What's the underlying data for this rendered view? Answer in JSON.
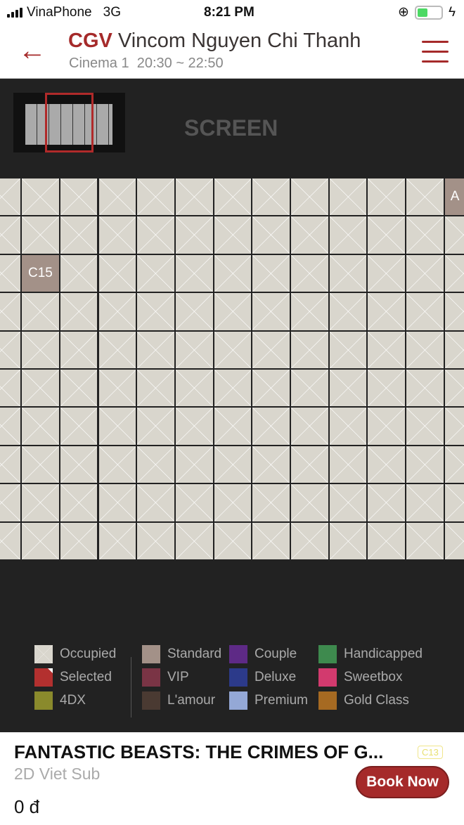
{
  "status": {
    "carrier": "VinaPhone",
    "network": "3G",
    "time": "8:21 PM"
  },
  "header": {
    "brand": "CGV",
    "cinema_name": "Vincom Nguyen Chi Thanh",
    "subtitle": "Cinema 1  20:30 ~ 22:50"
  },
  "seatmap": {
    "screen_label": "SCREEN",
    "rows": 10,
    "columns": 13,
    "available_seats": [
      {
        "label": "A",
        "row": 0,
        "col": 12,
        "type": "Standard"
      },
      {
        "label": "C15",
        "row": 2,
        "col": 1,
        "type": "Standard"
      }
    ]
  },
  "legend": [
    {
      "label": "Occupied",
      "color": "#d9d6cd"
    },
    {
      "label": "Selected",
      "color": "#b3302f"
    },
    {
      "label": "4DX",
      "color": "#8a8a2c"
    },
    {
      "label": "Standard",
      "color": "#a39188"
    },
    {
      "label": "VIP",
      "color": "#7a3445"
    },
    {
      "label": "L'amour",
      "color": "#4a3a32"
    },
    {
      "label": "Couple",
      "color": "#5e2a86"
    },
    {
      "label": "Deluxe",
      "color": "#2c3a8a"
    },
    {
      "label": "Premium",
      "color": "#94a8d6"
    },
    {
      "label": "Handicapped",
      "color": "#3e8a4e"
    },
    {
      "label": "Sweetbox",
      "color": "#d23a6e"
    },
    {
      "label": "Gold Class",
      "color": "#a66a22"
    }
  ],
  "movie": {
    "title": "FANTASTIC BEASTS: THE CRIMES OF G...",
    "rating": "C13",
    "format": "2D Viet Sub",
    "price": "0 đ",
    "book_label": "Book Now"
  }
}
